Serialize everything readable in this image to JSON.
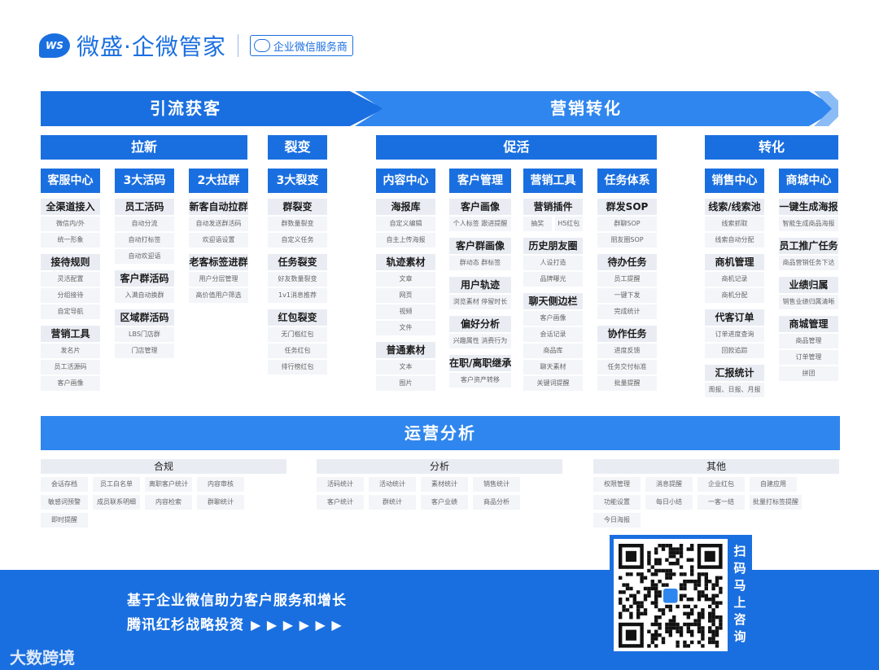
{
  "header": {
    "logo_text": "WS",
    "brand": "微盛·企微管家",
    "partner_label": "企业微信服务商"
  },
  "banner": {
    "left": "引流获客",
    "right": "营销转化"
  },
  "sections": {
    "laxin": "拉新",
    "liebian": "裂变",
    "cuohuo": "促活",
    "zhuanhua": "转化"
  },
  "columns": {
    "kefu": {
      "header": "客服中心",
      "groups": [
        {
          "title": "全渠道接入",
          "items": [
            "微信内/外",
            "统一形象"
          ]
        },
        {
          "title": "接待规则",
          "items": [
            "灵活配置",
            "分组接待",
            "自定导航"
          ]
        },
        {
          "title": "营销工具",
          "items": [
            "发名片",
            "员工活源码",
            "客户画像"
          ]
        }
      ]
    },
    "huoma": {
      "header": "3大活码",
      "groups": [
        {
          "title": "员工活码",
          "items": [
            "自动分流",
            "自动打标签",
            "自动欢迎语"
          ]
        },
        {
          "title": "客户群活码",
          "items": [
            "入满自动换群"
          ]
        },
        {
          "title": "区域群活码",
          "items": [
            "LBS门店群",
            "门店管理"
          ]
        }
      ]
    },
    "laqun": {
      "header": "2大拉群",
      "groups": [
        {
          "title": "新客自动拉群",
          "items": [
            "自动发送群活码",
            "欢迎语设置"
          ]
        },
        {
          "title": "老客标签进群",
          "items": [
            "用户分层管理",
            "高价值用户筛选"
          ]
        }
      ]
    },
    "liebian": {
      "header": "3大裂变",
      "groups": [
        {
          "title": "群裂变",
          "items": [
            "群数量裂变",
            "自定义任务"
          ]
        },
        {
          "title": "任务裂变",
          "items": [
            "好友数量裂变",
            "1v1消息推荐"
          ]
        },
        {
          "title": "红包裂变",
          "items": [
            "无门槛红包",
            "任务红包",
            "排行榜红包"
          ]
        }
      ]
    },
    "neirong": {
      "header": "内容中心",
      "groups": [
        {
          "title": "海报库",
          "items": [
            "自定义编辑",
            "自主上传海报"
          ]
        },
        {
          "title": "轨迹素材",
          "items": [
            "文章",
            "网页",
            "视频",
            "文件"
          ]
        },
        {
          "title": "普通素材",
          "items": [
            "文本",
            "图片"
          ]
        }
      ]
    },
    "kehu": {
      "header": "客户管理",
      "groups": [
        {
          "title": "客户画像",
          "items": [
            "个人标签 跟进提醒"
          ]
        },
        {
          "title": "客户群画像",
          "items": [
            "群动态   群标签"
          ]
        },
        {
          "title": "用户轨迹",
          "items": [
            "浏览素材 停留时长"
          ]
        },
        {
          "title": "偏好分析",
          "items": [
            "兴趣属性 消费行为"
          ]
        },
        {
          "title": "在职/离职继承",
          "items": [
            "客户资产转移"
          ]
        }
      ]
    },
    "yingxiao": {
      "header": "营销工具",
      "groups": [
        {
          "title": "营销插件",
          "items_row": [
            "抽奖",
            "H5红包"
          ]
        },
        {
          "title": "历史朋友圈",
          "items": [
            "人设打造",
            "品牌曝光"
          ]
        },
        {
          "title": "聊天侧边栏",
          "items": [
            "客户画像",
            "会话记录",
            "商品库",
            "聊天素材",
            "关键词提醒"
          ]
        }
      ]
    },
    "renwu": {
      "header": "任务体系",
      "groups": [
        {
          "title": "群发SOP",
          "items": [
            "群聊SOP",
            "朋友圈SOP"
          ]
        },
        {
          "title": "待办任务",
          "items": [
            "员工提醒",
            "一键下发",
            "完成统计"
          ]
        },
        {
          "title": "协作任务",
          "items": [
            "进度反馈",
            "任务交付标准",
            "批量提醒"
          ]
        }
      ]
    },
    "xiaoshou": {
      "header": "销售中心",
      "groups": [
        {
          "title": "线索/线索池",
          "items": [
            "线索抓取",
            "线索自动分配"
          ]
        },
        {
          "title": "商机管理",
          "items": [
            "商机记录",
            "商机分配"
          ]
        },
        {
          "title": "代客订单",
          "items": [
            "订单进度查询",
            "回款追踪"
          ]
        },
        {
          "title": "汇报统计",
          "items": [
            "周报、日报、月报"
          ]
        }
      ]
    },
    "shangcheng": {
      "header": "商城中心",
      "groups": [
        {
          "title": "一键生成海报",
          "items": [
            "智能生成商品海报"
          ]
        },
        {
          "title": "员工推广任务",
          "items": [
            "商品营销任务下达"
          ]
        },
        {
          "title": "业绩归属",
          "items": [
            "销售业绩归属清晰"
          ]
        },
        {
          "title": "商城管理",
          "items": [
            "商品管理",
            "订单管理",
            "拼团"
          ]
        }
      ]
    }
  },
  "ops": {
    "title": "运营分析",
    "heguī": {
      "title": "合规",
      "items": [
        "会话存档",
        "员工白名单",
        "离职客户统计",
        "内容审核",
        "敏感词预警",
        "成员联系明细",
        "内容检索",
        "群聊统计",
        "即时提醒"
      ]
    },
    "fenxi": {
      "title": "分析",
      "items": [
        "活码统计",
        "活动统计",
        "素材统计",
        "销售统计",
        "客户统计",
        "群统计",
        "客户业绩",
        "商品分析"
      ]
    },
    "qita": {
      "title": "其他",
      "items": [
        "权限管理",
        "消息提醒",
        "企业红包",
        "自建应用",
        "功能设置",
        "每日小结",
        "一客一结",
        "批量打标签提醒",
        "今日海报"
      ]
    }
  },
  "footer": {
    "tagline1": "基于企业微信助力客户服务和增长",
    "tagline2": "腾讯红杉战略投资",
    "chevrons": "▶ ▶ ▶ ▶ ▶ ▶",
    "qr_side_text": "扫码马上咨询",
    "watermark": "大数跨境"
  },
  "colors": {
    "primary": "#1a6fe0",
    "ops_bar": "#2f86ee",
    "item_bg": "#f3f5f8",
    "title_bg": "#e9edf3"
  }
}
